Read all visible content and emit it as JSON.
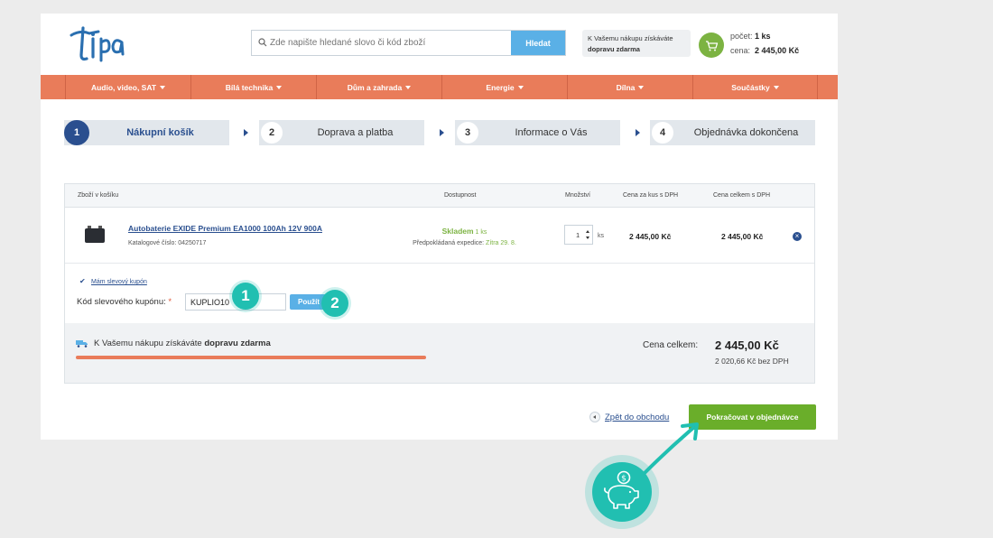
{
  "header": {
    "logo_text": "tipa",
    "search_placeholder": "Zde napište hledané slovo či kód zboží",
    "search_button": "Hledat",
    "shipping_line1": "K Vašemu nákupu získáváte",
    "shipping_line2": "dopravu zdarma",
    "cart_count_label": "počet:",
    "cart_count_value": "1 ks",
    "cart_price_label": "cena:",
    "cart_price_value": "2 445,00 Kč"
  },
  "nav": {
    "items": [
      "Audio, video, SAT",
      "Bílá technika",
      "Dům a zahrada",
      "Energie",
      "Dílna",
      "Součástky"
    ]
  },
  "steps": [
    {
      "num": "1",
      "label": "Nákupní košík"
    },
    {
      "num": "2",
      "label": "Doprava a platba"
    },
    {
      "num": "3",
      "label": "Informace o Vás"
    },
    {
      "num": "4",
      "label": "Objednávka dokončena"
    }
  ],
  "cart": {
    "columns": {
      "product": "Zboží v košíku",
      "availability": "Dostupnost",
      "quantity": "Množství",
      "unit_price": "Cena za kus s DPH",
      "total_price": "Cena celkem s DPH"
    },
    "item": {
      "name": "Autobaterie EXIDE Premium EA1000 100Ah 12V 900A",
      "code_label": "Katalogové číslo:",
      "code": "04250717",
      "stock": "Skladem",
      "stock_qty": "1 ks",
      "expedition_label": "Předpokládaná expedice:",
      "expedition_value": "Zítra 29. 8.",
      "qty": "1",
      "qty_unit": "ks",
      "unit_price": "2 445,00 Kč",
      "total_price": "2 445,00 Kč"
    },
    "coupon": {
      "checkbox_label": "Mám slevový kupón",
      "label": "Kód slevového kupónu:",
      "required_mark": "*",
      "value": "KUPLIO10",
      "apply_button": "Použít"
    },
    "summary": {
      "free_shipping_prefix": "K Vašemu nákupu získáváte",
      "free_shipping_bold": "dopravu zdarma",
      "total_label": "Cena celkem:",
      "total_value": "2 445,00 Kč",
      "total_net": "2 020,66 Kč bez DPH"
    }
  },
  "actions": {
    "back_link": "Zpět do obchodu",
    "continue_button": "Pokračovat v objednávce"
  },
  "annotations": {
    "badge1": "1",
    "badge2": "2"
  },
  "colors": {
    "nav_orange": "#e97c5a",
    "brand_blue": "#2a4f8f",
    "accent_green": "#6aae2a",
    "annotation_teal": "#21bfb1",
    "button_blue": "#5ab0e6"
  }
}
